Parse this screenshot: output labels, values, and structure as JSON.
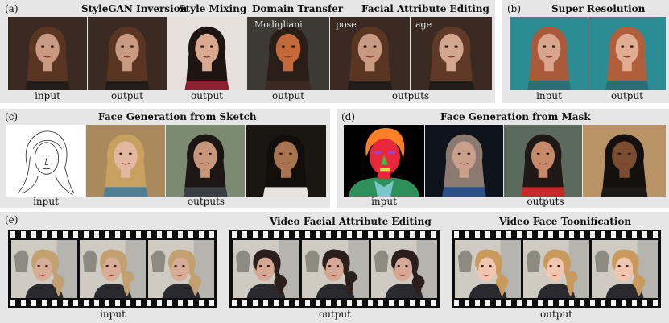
{
  "panels": {
    "a": {
      "tag": "(a)",
      "titles": [
        "StyleGAN Inversion",
        "Style Mixing",
        "Domain Transfer",
        "Facial Attribute Editing"
      ],
      "overlays": [
        "Modigliani",
        "pose",
        "age"
      ],
      "captions": [
        "input",
        "output",
        "output",
        "output",
        "outputs"
      ]
    },
    "b": {
      "tag": "(b)",
      "title": "Super Resolution",
      "captions": [
        "input",
        "output"
      ]
    },
    "c": {
      "tag": "(c)",
      "title": "Face Generation from Sketch",
      "captions": [
        "input",
        "outputs"
      ]
    },
    "d": {
      "tag": "(d)",
      "title": "Face Generation from Mask",
      "captions": [
        "input",
        "outputs"
      ]
    },
    "e": {
      "tag": "(e)",
      "titles": [
        "Video Facial Attribute Editing",
        "Video Face Toonification"
      ],
      "captions": [
        "input",
        "output",
        "output"
      ]
    }
  },
  "colors": {
    "panel_bg": "#e6e6e6",
    "film": "#0d0d0d"
  }
}
